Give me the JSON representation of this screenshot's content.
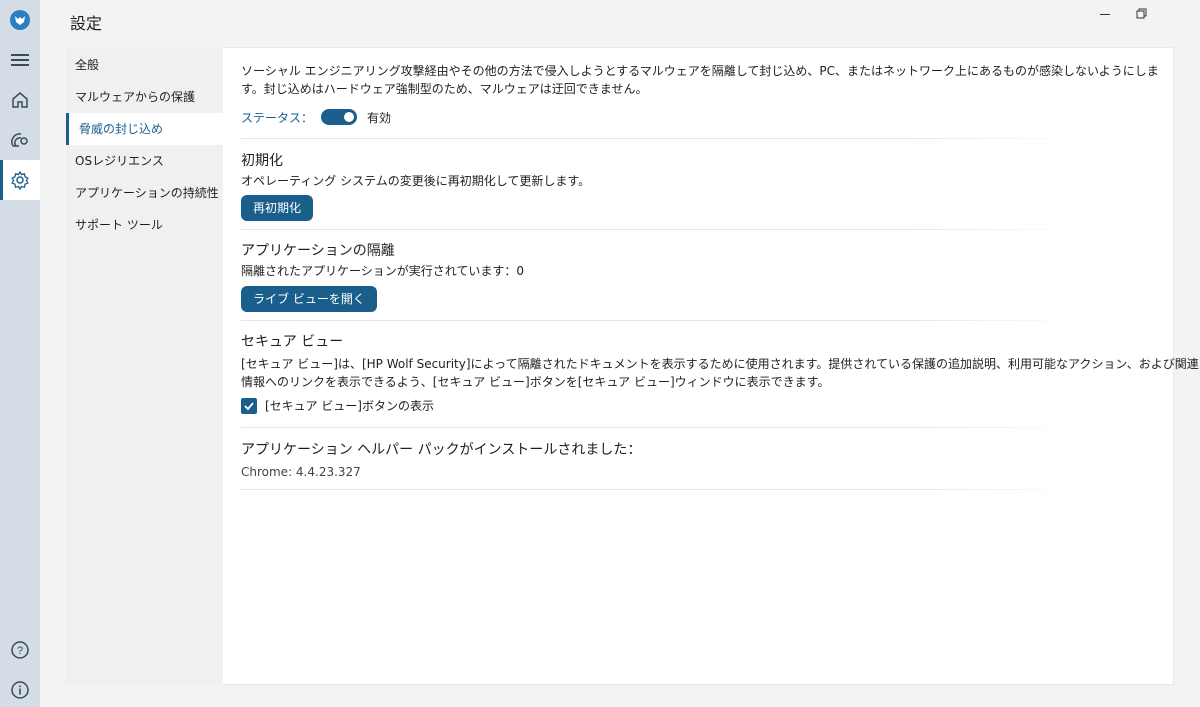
{
  "window": {
    "title": "設定",
    "minimize_icon": "minimize-icon",
    "restore_icon": "restore-icon"
  },
  "rail": {
    "items": [
      {
        "name": "app-logo",
        "icon": "wolf-logo-icon"
      },
      {
        "name": "menu",
        "icon": "hamburger-icon"
      },
      {
        "name": "home",
        "icon": "home-icon"
      },
      {
        "name": "threats",
        "icon": "radar-icon"
      },
      {
        "name": "settings",
        "icon": "gear-icon"
      },
      {
        "name": "help",
        "icon": "help-icon"
      },
      {
        "name": "info",
        "icon": "info-icon"
      }
    ]
  },
  "subnav": {
    "items": [
      {
        "label": "全般"
      },
      {
        "label": "マルウェアからの保護"
      },
      {
        "label": "脅威の封じ込め"
      },
      {
        "label": "OSレジリエンス"
      },
      {
        "label": "アプリケーションの持続性"
      },
      {
        "label": "サポート ツール"
      }
    ],
    "active_index": 2
  },
  "content": {
    "intro_line1": "ソーシャル エンジニアリング攻撃経由やその他の方法で侵入しようとするマルウェアを隔離して封じ込め、PC、またはネットワーク上にあるものが感染しないようにしま",
    "intro_line2": "す。封じ込めはハードウェア強制型のため、マルウェアは迂回できません。",
    "status_label": "ステータス：",
    "status_value": "有効",
    "reinit": {
      "title": "初期化",
      "desc": "オペレーティング システムの変更後に再初期化して更新します。",
      "button": "再初期化"
    },
    "isolation": {
      "title": "アプリケーションの隔離",
      "desc": "隔離されたアプリケーションが実行されています：0",
      "button": "ライブ ビューを開く"
    },
    "secure_view": {
      "title": "セキュア ビュー",
      "desc_line1": "[セキュア ビュー]は、[HP Wolf Security]によって隔離されたドキュメントを表示するために使用されます。提供されている保護の追加説明、利用可能なアクション、および関連",
      "desc_line2": "情報へのリンクを表示できるよう、[セキュア ビュー]ボタンを[セキュア ビュー]ウィンドウに表示できます。",
      "checkbox_label": "[セキュア ビュー]ボタンの表示",
      "checked": true
    },
    "helper": {
      "title": "アプリケーション ヘルパー パックがインストールされました：",
      "version": "Chrome: 4.4.23.327"
    }
  },
  "colors": {
    "accent": "#1a5e8c",
    "rail_bg": "#d4dde6",
    "subnav_bg": "#f0f0f0"
  }
}
